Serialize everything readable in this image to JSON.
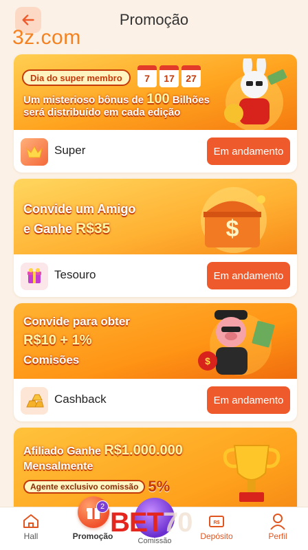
{
  "header": {
    "title": "Promoção",
    "logo": "3z.com",
    "back_icon": "arrow-left-icon"
  },
  "cards": [
    {
      "banner_lines": [
        "Dia do super membro",
        "Um misterioso bônus de",
        "100",
        "Bilhões",
        "será distribuído em cada edição"
      ],
      "calendar_days": [
        "7",
        "17",
        "27"
      ],
      "title": "Super",
      "icon": "crown-icon",
      "status": "Em andamento"
    },
    {
      "banner_lines": [
        "Convide um Amigo",
        "e Ganhe",
        "R$35"
      ],
      "title": "Tesouro",
      "icon": "gift-box-icon",
      "status": "Em andamento"
    },
    {
      "banner_lines": [
        "Convide para obter",
        "R$10 + 1%",
        "Comisões"
      ],
      "title": "Cashback",
      "icon": "gold-bars-icon",
      "status": "Em andamento"
    },
    {
      "banner_lines": [
        "Afiliado Ganhe",
        "R$1.000.000",
        "Mensalmente",
        "Agente exclusivo comissão",
        "5%"
      ]
    }
  ],
  "nav": {
    "items": [
      {
        "label": "Hall",
        "icon": "home-icon"
      },
      {
        "label": "Promoção",
        "icon": "gift-icon",
        "badge": "2"
      },
      {
        "label": "Comissão",
        "icon": "commission-icon"
      },
      {
        "label": "Depósito",
        "icon": "deposit-icon"
      },
      {
        "label": "Perfil",
        "icon": "user-icon"
      }
    ]
  },
  "watermark": {
    "brand": "BET",
    "suffix": "70"
  },
  "colors": {
    "accent": "#ee5a2b",
    "logo": "#f58220",
    "background": "#fbf1e6"
  }
}
